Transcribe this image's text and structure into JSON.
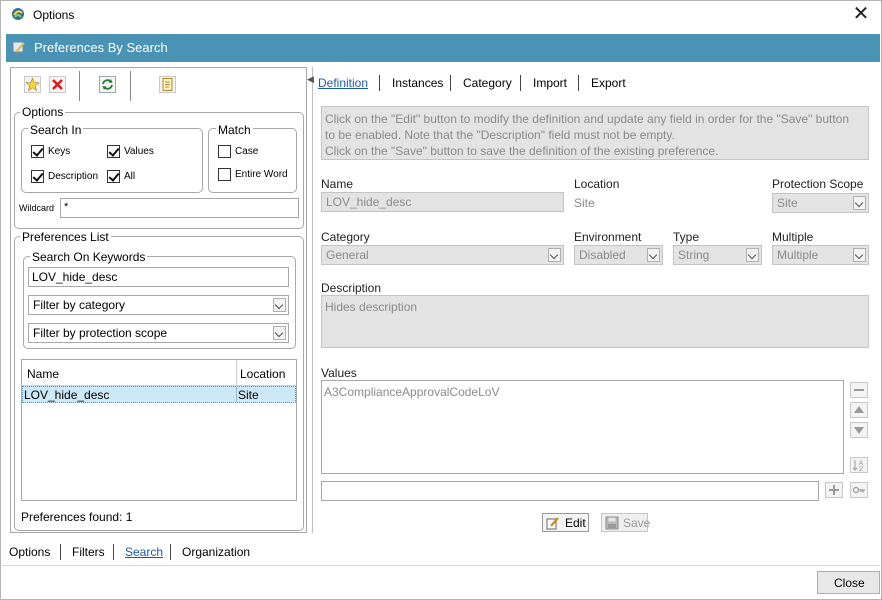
{
  "window": {
    "title": "Options"
  },
  "banner": {
    "title": "Preferences By Search"
  },
  "toolbar": {
    "icons": [
      "new-star-icon",
      "delete-x-icon",
      "refresh-icon",
      "report-icon"
    ]
  },
  "options": {
    "legend": "Options",
    "search_in": {
      "legend": "Search In",
      "keys": {
        "label": "Keys",
        "checked": true
      },
      "values": {
        "label": "Values",
        "checked": true
      },
      "description": {
        "label": "Description",
        "checked": true
      },
      "all": {
        "label": "All",
        "checked": true
      }
    },
    "match": {
      "legend": "Match",
      "case": {
        "label": "Case",
        "checked": false
      },
      "entire_word": {
        "label": "Entire Word",
        "checked": false
      }
    },
    "wildcard": {
      "label": "Wildcard",
      "value": "*"
    }
  },
  "preferences_list": {
    "legend": "Preferences List",
    "search_on_keywords": {
      "legend": "Search On Keywords",
      "value": "LOV_hide_desc"
    },
    "filter_category": "Filter by category",
    "filter_scope": "Filter by protection scope",
    "table": {
      "columns": [
        "Name",
        "Location"
      ],
      "rows": [
        {
          "name": "LOV_hide_desc",
          "location": "Site"
        }
      ]
    },
    "found": "Preferences found: 1"
  },
  "bottom_tabs": [
    "Options",
    "Filters",
    "Search",
    "Organization"
  ],
  "right_tabs": [
    "Definition",
    "Instances",
    "Category",
    "Import",
    "Export"
  ],
  "info_text": [
    "Click on the \"Edit\" button to modify the definition and update any field in order for the \"Save\" button",
    "to be enabled. Note that the \"Description\" field must not be empty.",
    "Click on the \"Save\" button to save the definition of the existing preference."
  ],
  "definition": {
    "name_label": "Name",
    "name_value": "LOV_hide_desc",
    "location_label": "Location",
    "location_value": "Site",
    "protection_label": "Protection Scope",
    "protection_value": "Site",
    "category_label": "Category",
    "category_value": "General",
    "environment_label": "Environment",
    "environment_value": "Disabled",
    "type_label": "Type",
    "type_value": "String",
    "multiple_label": "Multiple",
    "multiple_value": "Multiple",
    "description_label": "Description",
    "description_value": "Hides description",
    "values_label": "Values",
    "values_list": [
      "A3ComplianceApprovalCodeLoV"
    ],
    "new_value": ""
  },
  "actions": {
    "edit": "Edit",
    "save": "Save",
    "close": "Close"
  }
}
